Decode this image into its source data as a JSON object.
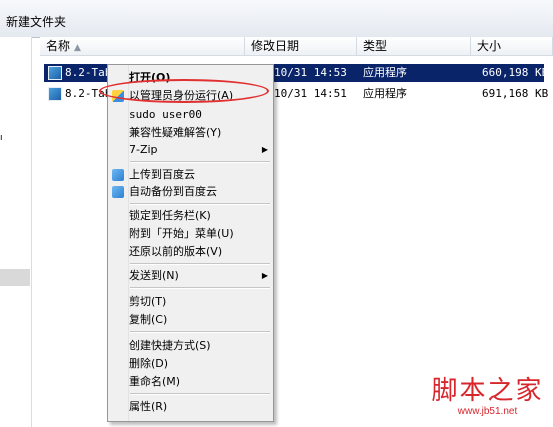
{
  "window": {
    "folder_title": "新建文件夹"
  },
  "columns": {
    "name": "名称",
    "modified": "修改日期",
    "type": "类型",
    "size": "大小"
  },
  "files": [
    {
      "name": "8.2-Tab",
      "modified": "10/31 14:53",
      "type": "应用程序",
      "size": "660,198 KB",
      "selected": true
    },
    {
      "name": "8.2-Tab",
      "modified": "10/31 14:51",
      "type": "应用程序",
      "size": "691,168 KB",
      "selected": false
    }
  ],
  "navpane": {
    "mark": "ı"
  },
  "context_menu": {
    "open": "打开(O)",
    "run_as_admin": "以管理员身份运行(A)",
    "sudo": "sudo user00",
    "compat": "兼容性疑难解答(Y)",
    "zip": "7-Zip",
    "upload_baidu": "上传到百度云",
    "backup_baidu": "自动备份到百度云",
    "pin_taskbar": "锁定到任务栏(K)",
    "pin_start": "附到「开始」菜单(U)",
    "restore": "还原以前的版本(V)",
    "send_to": "发送到(N)",
    "cut": "剪切(T)",
    "copy": "复制(C)",
    "create_shortcut": "创建快捷方式(S)",
    "delete": "删除(D)",
    "rename": "重命名(M)",
    "properties": "属性(R)"
  },
  "watermark": {
    "title": "脚本之家",
    "url": "www.jb51.net"
  },
  "colors": {
    "selection": "#0a246a",
    "highlight_oval": "#e03030",
    "watermark": "#d7262c"
  }
}
